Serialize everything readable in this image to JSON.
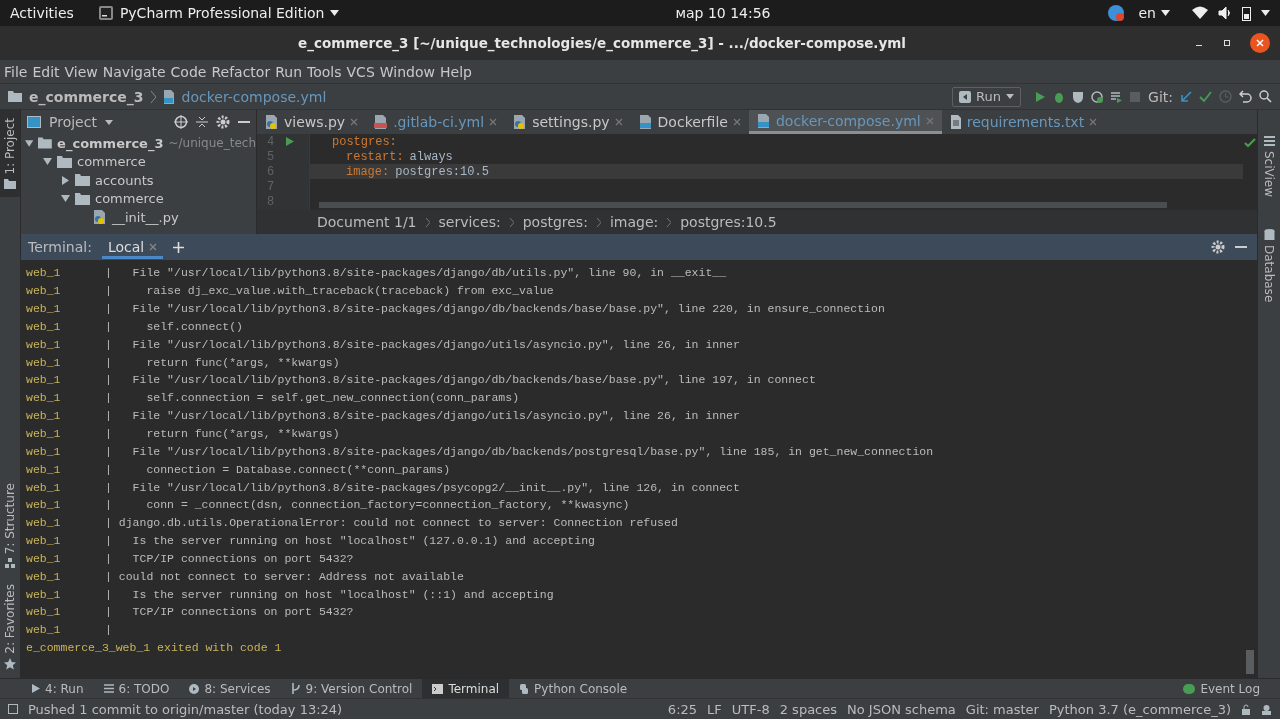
{
  "top_bar": {
    "activities": "Activities",
    "app_menu": "PyCharm Professional Edition",
    "clock": "мар 10  14:56",
    "language": "en"
  },
  "window": {
    "title": "e_commerce_3 [~/unique_technologies/e_commerce_3] - .../docker-compose.yml"
  },
  "menu": [
    "File",
    "Edit",
    "View",
    "Navigate",
    "Code",
    "Refactor",
    "Run",
    "Tools",
    "VCS",
    "Window",
    "Help"
  ],
  "nav_bar": {
    "breadcrumb": [
      "e_commerce_3",
      "docker-compose.yml"
    ],
    "run_config": "Run",
    "git_label": "Git:"
  },
  "left_strip": [
    {
      "label": "1: Project",
      "selected": true
    },
    {
      "label": "7: Structure",
      "selected": false
    },
    {
      "label": "2: Favorites",
      "selected": false
    }
  ],
  "right_strip": [
    "SciView",
    "Database"
  ],
  "project_panel": {
    "title": "Project",
    "tree": [
      {
        "name": "e_commerce_3",
        "hint": "~/unique_tech",
        "kind": "folder",
        "expanded": true,
        "children": [
          {
            "name": "commerce",
            "kind": "folder",
            "expanded": true,
            "children": [
              {
                "name": "accounts",
                "kind": "folder",
                "expanded": false
              },
              {
                "name": "commerce",
                "kind": "folder",
                "expanded": true,
                "children": [
                  {
                    "name": "__init__.py",
                    "kind": "python"
                  }
                ]
              }
            ]
          }
        ]
      }
    ]
  },
  "tabs": [
    {
      "label": "views.py",
      "kind": "python",
      "modified": false,
      "selected": false
    },
    {
      "label": ".gitlab-ci.yml",
      "kind": "yml",
      "modified": true,
      "selected": false
    },
    {
      "label": "settings.py",
      "kind": "python",
      "modified": false,
      "selected": false
    },
    {
      "label": "Dockerfile",
      "kind": "docker",
      "modified": false,
      "selected": false
    },
    {
      "label": "docker-compose.yml",
      "kind": "docker",
      "modified": true,
      "selected": true
    },
    {
      "label": "requirements.txt",
      "kind": "text",
      "modified": true,
      "selected": false
    }
  ],
  "editor": {
    "lines": [
      {
        "number": "4",
        "kind": "section",
        "key": "postgres:",
        "current": false
      },
      {
        "number": "5",
        "kind": "property",
        "key": "restart:",
        "value": "always",
        "current": false
      },
      {
        "number": "6",
        "kind": "property",
        "key": "image:",
        "value": "postgres:10.5",
        "current": true
      },
      {
        "number": "7",
        "kind": "blank",
        "current": false
      },
      {
        "number": "8",
        "kind": "blank",
        "current": false
      }
    ],
    "breadcrumbs": [
      "Document 1/1",
      "services:",
      "postgres:",
      "image:",
      "postgres:10.5"
    ]
  },
  "terminal": {
    "label": "Terminal:",
    "tab": "Local",
    "lines": [
      {
        "kind": "file",
        "prefix": "web_1",
        "separator": "|",
        "text": "File \"/usr/local/lib/python3.8/site-packages/django/db/utils.py\", line 90, in __exit__"
      },
      {
        "kind": "code",
        "prefix": "web_1",
        "separator": "|",
        "text": "raise dj_exc_value.with_traceback(traceback) from exc_value"
      },
      {
        "kind": "file",
        "prefix": "web_1",
        "separator": "|",
        "text": "File \"/usr/local/lib/python3.8/site-packages/django/db/backends/base/base.py\", line 220, in ensure_connection"
      },
      {
        "kind": "code",
        "prefix": "web_1",
        "separator": "|",
        "text": "self.connect()"
      },
      {
        "kind": "file",
        "prefix": "web_1",
        "separator": "|",
        "text": "File \"/usr/local/lib/python3.8/site-packages/django/utils/asyncio.py\", line 26, in inner"
      },
      {
        "kind": "code",
        "prefix": "web_1",
        "separator": "|",
        "text": "return func(*args, **kwargs)"
      },
      {
        "kind": "file",
        "prefix": "web_1",
        "separator": "|",
        "text": "File \"/usr/local/lib/python3.8/site-packages/django/db/backends/base/base.py\", line 197, in connect"
      },
      {
        "kind": "code",
        "prefix": "web_1",
        "separator": "|",
        "text": "self.connection = self.get_new_connection(conn_params)"
      },
      {
        "kind": "file",
        "prefix": "web_1",
        "separator": "|",
        "text": "File \"/usr/local/lib/python3.8/site-packages/django/utils/asyncio.py\", line 26, in inner"
      },
      {
        "kind": "code",
        "prefix": "web_1",
        "separator": "|",
        "text": "return func(*args, **kwargs)"
      },
      {
        "kind": "file",
        "prefix": "web_1",
        "separator": "|",
        "text": "File \"/usr/local/lib/python3.8/site-packages/django/db/backends/postgresql/base.py\", line 185, in get_new_connection"
      },
      {
        "kind": "code",
        "prefix": "web_1",
        "separator": "|",
        "text": "connection = Database.connect(**conn_params)"
      },
      {
        "kind": "file",
        "prefix": "web_1",
        "separator": "|",
        "text": "File \"/usr/local/lib/python3.8/site-packages/psycopg2/__init__.py\", line 126, in connect"
      },
      {
        "kind": "code",
        "prefix": "web_1",
        "separator": "|",
        "text": "conn = _connect(dsn, connection_factory=connection_factory, **kwasync)"
      },
      {
        "kind": "message",
        "prefix": "web_1",
        "separator": "|",
        "text": "django.db.utils.OperationalError: could not connect to server: Connection refused"
      },
      {
        "kind": "file",
        "prefix": "web_1",
        "separator": "|",
        "text": "Is the server running on host \"localhost\" (127.0.0.1) and accepting"
      },
      {
        "kind": "file",
        "prefix": "web_1",
        "separator": "|",
        "text": "TCP/IP connections on port 5432?"
      },
      {
        "kind": "message",
        "prefix": "web_1",
        "separator": "|",
        "text": "could not connect to server: Address not available"
      },
      {
        "kind": "file",
        "prefix": "web_1",
        "separator": "|",
        "text": "Is the server running on host \"localhost\" (::1) and accepting"
      },
      {
        "kind": "file",
        "prefix": "web_1",
        "separator": "|",
        "text": "TCP/IP connections on port 5432?"
      },
      {
        "kind": "blank",
        "prefix": "web_1",
        "separator": "|"
      },
      {
        "kind": "exit",
        "text": "e_commerce_3_web_1 exited with code 1"
      }
    ]
  },
  "tool_tabs": [
    {
      "label": "4: Run",
      "selected": false
    },
    {
      "label": "6: TODO",
      "selected": false
    },
    {
      "label": "8: Services",
      "selected": false
    },
    {
      "label": "9: Version Control",
      "selected": false
    },
    {
      "label": "Terminal",
      "selected": true
    },
    {
      "label": "Python Console",
      "selected": false
    }
  ],
  "event_log": "Event Log",
  "status_bar": {
    "message": "Pushed 1 commit to origin/master (today 13:24)",
    "items": [
      "6:25",
      "LF",
      "UTF-8",
      "2 spaces",
      "No JSON schema",
      "Git: master",
      "Python 3.7 (e_commerce_3)"
    ]
  }
}
